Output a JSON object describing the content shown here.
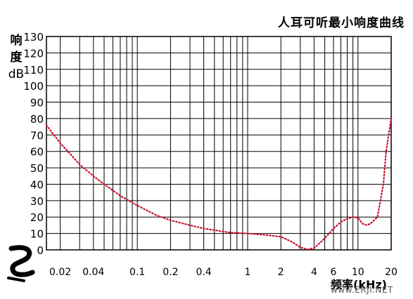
{
  "title": "人耳可听最小响度曲线",
  "chart_data": {
    "type": "line",
    "title": "人耳可听最小响度曲线",
    "ylabel_lines": [
      "响",
      "度"
    ],
    "ylabel_unit": "dB",
    "xlabel": "频率(kHz)",
    "x_scale": "log",
    "xlim": [
      0.015,
      20
    ],
    "ylim": [
      0,
      130
    ],
    "grid": true,
    "y_ticks": [
      0,
      10,
      20,
      30,
      40,
      50,
      60,
      70,
      80,
      90,
      100,
      110,
      120,
      130
    ],
    "y_tick_labels": [
      "0",
      "10",
      "20",
      "30",
      "40",
      "50",
      "60",
      "70",
      "80",
      "90",
      "100",
      "110",
      "120",
      "130"
    ],
    "x_ticks": [
      0.02,
      0.04,
      0.1,
      0.2,
      0.4,
      1,
      2,
      4,
      6,
      10,
      20
    ],
    "x_tick_labels": [
      "0.02",
      "0.04",
      "0.1",
      "0.2",
      "0.4",
      "1",
      "2",
      "4",
      "6",
      "10",
      "20"
    ],
    "line_color": "#c8102e",
    "series": [
      {
        "x": [
          0.015,
          0.02,
          0.025,
          0.03,
          0.04,
          0.05,
          0.07,
          0.1,
          0.15,
          0.2,
          0.3,
          0.4,
          0.5,
          0.7,
          1,
          1.5,
          2,
          2.5,
          3,
          3.5,
          4,
          5,
          6,
          7,
          8,
          9,
          10,
          11,
          12,
          13,
          15,
          17,
          18,
          20
        ],
        "y": [
          76,
          65,
          58,
          52,
          45,
          40,
          33,
          27,
          21,
          18,
          15,
          13,
          12,
          10.5,
          10,
          9,
          8,
          5,
          1.5,
          0.3,
          1,
          7,
          13,
          17,
          19,
          20,
          19.5,
          16,
          15,
          16,
          20,
          40,
          60,
          80
        ]
      }
    ]
  },
  "watermark": "www.ERJI.NET"
}
